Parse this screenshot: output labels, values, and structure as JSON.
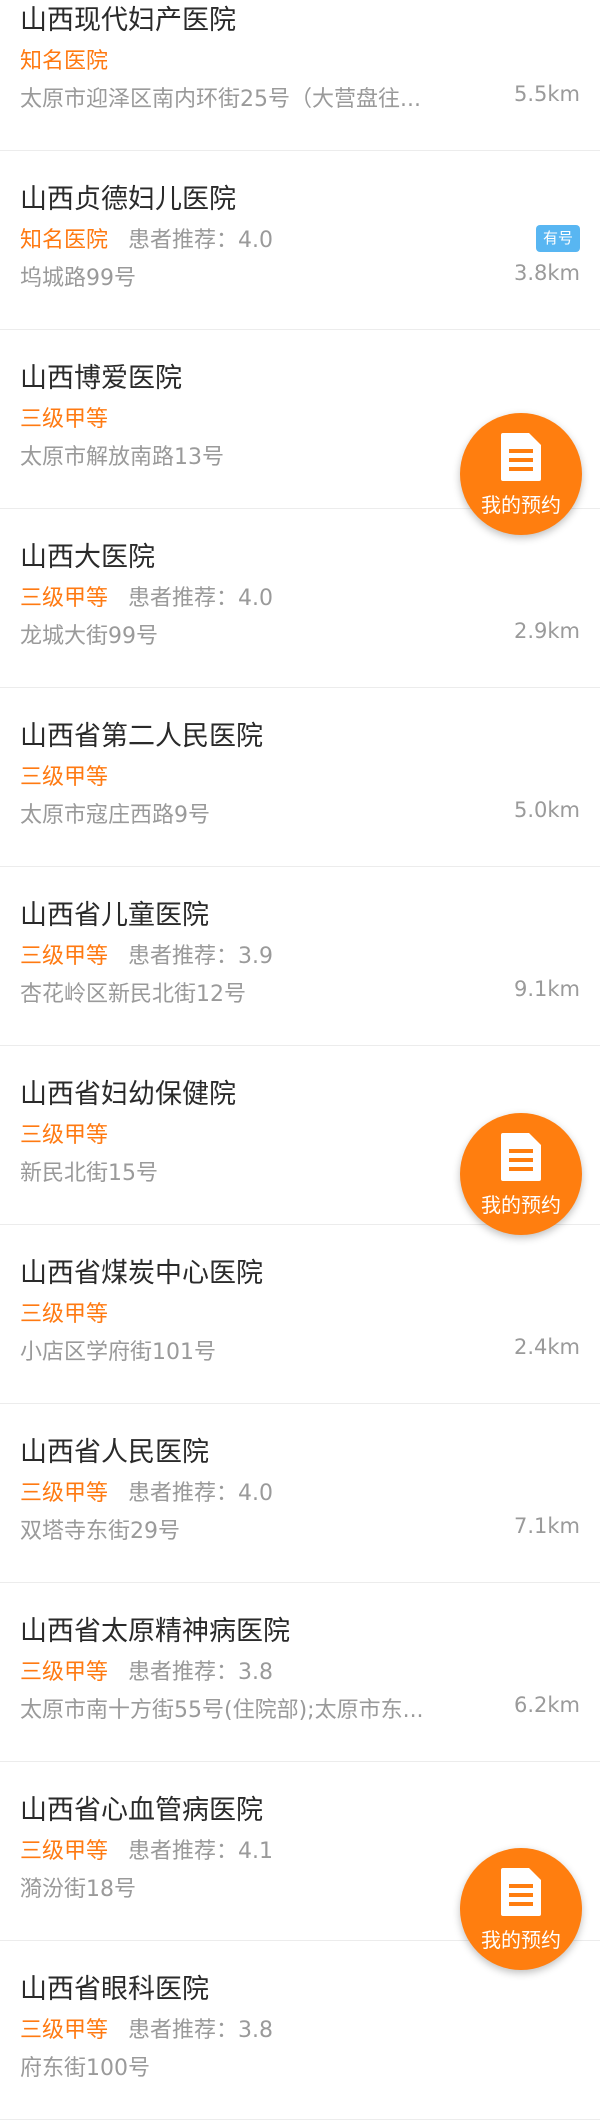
{
  "fab_label": "我的预约",
  "hospitals": [
    {
      "name": "山西现代妇产医院",
      "level": "知名医院",
      "recommend": "",
      "address": "太原市迎泽区南内环街25号（大营盘往...",
      "distance": "5.5km",
      "badge": ""
    },
    {
      "name": "山西贞德妇儿医院",
      "level": "知名医院",
      "recommend": "患者推荐：4.0",
      "address": "坞城路99号",
      "distance": "3.8km",
      "badge": "有号"
    },
    {
      "name": "山西博爱医院",
      "level": "三级甲等",
      "recommend": "",
      "address": "太原市解放南路13号",
      "distance": "",
      "badge": ""
    },
    {
      "name": "山西大医院",
      "level": "三级甲等",
      "recommend": "患者推荐：4.0",
      "address": "龙城大街99号",
      "distance": "2.9km",
      "badge": ""
    },
    {
      "name": "山西省第二人民医院",
      "level": "三级甲等",
      "recommend": "",
      "address": "太原市寇庄西路9号",
      "distance": "5.0km",
      "badge": ""
    },
    {
      "name": "山西省儿童医院",
      "level": "三级甲等",
      "recommend": "患者推荐：3.9",
      "address": "杏花岭区新民北街12号",
      "distance": "9.1km",
      "badge": ""
    },
    {
      "name": "山西省妇幼保健院",
      "level": "三级甲等",
      "recommend": "",
      "address": "新民北街15号",
      "distance": "",
      "badge": ""
    },
    {
      "name": "山西省煤炭中心医院",
      "level": "三级甲等",
      "recommend": "",
      "address": "小店区学府街101号",
      "distance": "2.4km",
      "badge": ""
    },
    {
      "name": "山西省人民医院",
      "level": "三级甲等",
      "recommend": "患者推荐：4.0",
      "address": "双塔寺东街29号",
      "distance": "7.1km",
      "badge": ""
    },
    {
      "name": "山西省太原精神病医院",
      "level": "三级甲等",
      "recommend": "患者推荐：3.8",
      "address": "太原市南十方街55号(住院部);太原市东...",
      "distance": "6.2km",
      "badge": ""
    },
    {
      "name": "山西省心血管病医院",
      "level": "三级甲等",
      "recommend": "患者推荐：4.1",
      "address": "漪汾街18号",
      "distance": "",
      "badge": ""
    },
    {
      "name": "山西省眼科医院",
      "level": "三级甲等",
      "recommend": "患者推荐：3.8",
      "address": "府东街100号",
      "distance": "",
      "badge": ""
    }
  ]
}
